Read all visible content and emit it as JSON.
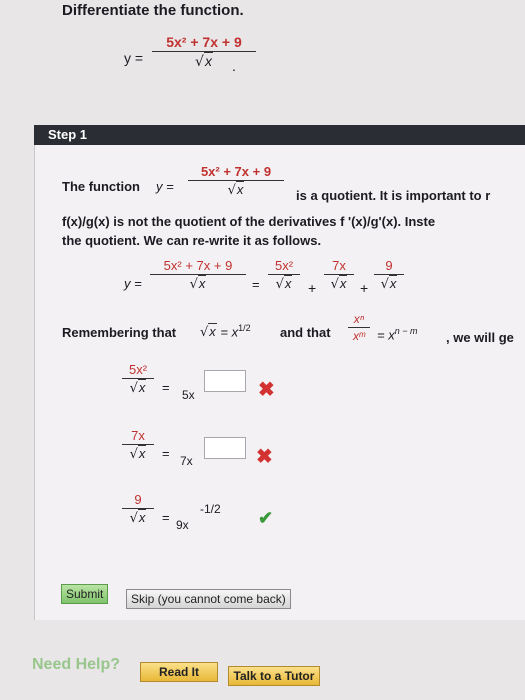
{
  "heading": "Differentiate the function.",
  "problem": {
    "lhs": "y =",
    "numerator": "5x² + 7x + 9",
    "denominator_var": "x",
    "trailing": "."
  },
  "step": {
    "label": "Step 1",
    "intro_prefix": "The function",
    "intro_y": "y =",
    "intro_num": "5x² + 7x + 9",
    "intro_den": "x",
    "intro_suffix": "is a quotient. It is important to r",
    "line2": "f(x)/g(x) is not the quotient of the derivatives f '(x)/g'(x). Inste",
    "line3": "the quotient. We can re-write it as follows.",
    "rewrite": {
      "lhs": "y =",
      "num_full": "5x² + 7x + 9",
      "t1_num": "5x²",
      "t2_num": "7x",
      "t3_num": "9",
      "den_var": "x",
      "eq": "=",
      "plus": "+"
    },
    "remember": {
      "prefix": "Remembering that",
      "sqrt_eq": "= x",
      "exp": "1/2",
      "and_that": "and that",
      "frac_num": "xⁿ",
      "frac_den": "xᵐ",
      "rhs": "= x",
      "rhs_exp": "n − m",
      "suffix": ", we will ge"
    },
    "answers": [
      {
        "num": "5x²",
        "den_var": "x",
        "eq": "=",
        "coef": "5x",
        "exp_value": "",
        "status": "wrong",
        "mark": "✖"
      },
      {
        "num": "7x",
        "den_var": "x",
        "eq": "=",
        "coef": "7x",
        "exp_value": "",
        "status": "wrong",
        "mark": "✖"
      },
      {
        "num": "9",
        "den_var": "x",
        "eq": "=",
        "coef": "9x",
        "exp_value": "-1/2",
        "status": "correct",
        "mark": "✔"
      }
    ]
  },
  "buttons": {
    "submit": "Submit",
    "skip": "Skip (you cannot come back)"
  },
  "help": {
    "label": "Need Help?",
    "read": "Read It",
    "tutor": "Talk to a Tutor"
  },
  "colors": {
    "header_bg": "#2a2d34",
    "wrong": "#d23232",
    "correct": "#3a9a3a",
    "fraction_red": "#c0312f"
  }
}
